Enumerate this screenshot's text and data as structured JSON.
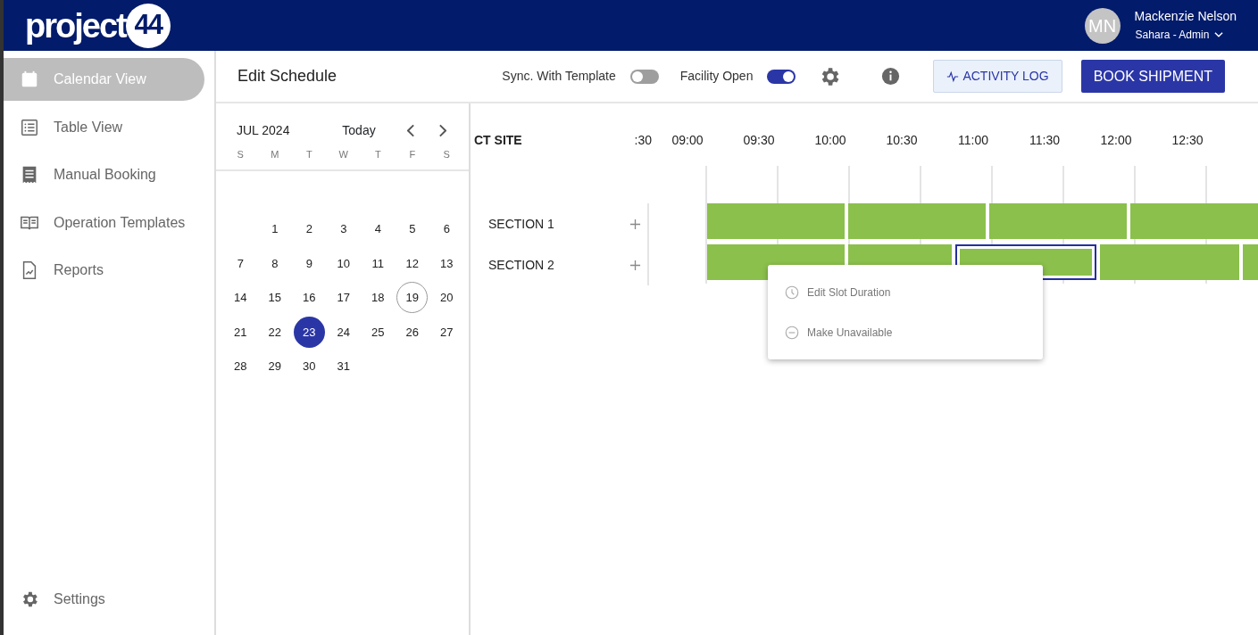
{
  "header": {
    "logo": {
      "word": "project",
      "number": "44"
    },
    "user": {
      "initials": "MN",
      "name": "Mackenzie Nelson",
      "role": "Sahara - Admin"
    }
  },
  "sidebar": {
    "items": [
      {
        "label": "Calendar View",
        "selected": true
      },
      {
        "label": "Table View",
        "selected": false
      },
      {
        "label": "Manual Booking",
        "selected": false
      },
      {
        "label": "Operation Templates",
        "selected": false
      },
      {
        "label": "Reports",
        "selected": false
      }
    ],
    "footer": {
      "label": "Settings"
    }
  },
  "toolbar": {
    "title": "Edit Schedule",
    "toggles": [
      {
        "label": "Sync. With Template",
        "on": false
      },
      {
        "label": "Facility Open",
        "on": true
      }
    ],
    "buttons": [
      {
        "label": "ACTIVITY LOG",
        "kind": "secondary"
      },
      {
        "label": "BOOK SHIPMENT",
        "kind": "primary"
      }
    ]
  },
  "calendar": {
    "month": "JUL 2024",
    "today_button": "Today",
    "weekdays": [
      "S",
      "M",
      "T",
      "W",
      "T",
      "F",
      "S"
    ],
    "days": [
      {
        "label": "1",
        "selected": false,
        "today": false
      },
      {
        "label": "2",
        "selected": false,
        "today": false
      },
      {
        "label": "3",
        "selected": false,
        "today": false
      },
      {
        "label": "4",
        "selected": false,
        "today": false
      },
      {
        "label": "5",
        "selected": false,
        "today": false
      },
      {
        "label": "6",
        "selected": false,
        "today": false
      },
      {
        "label": "7",
        "selected": false,
        "today": false
      },
      {
        "label": "8",
        "selected": false,
        "today": false
      },
      {
        "label": "9",
        "selected": false,
        "today": false
      },
      {
        "label": "10",
        "selected": false,
        "today": false
      },
      {
        "label": "11",
        "selected": false,
        "today": false
      },
      {
        "label": "12",
        "selected": false,
        "today": false
      },
      {
        "label": "13",
        "selected": false,
        "today": false
      },
      {
        "label": "14",
        "selected": false,
        "today": false
      },
      {
        "label": "15",
        "selected": false,
        "today": false
      },
      {
        "label": "16",
        "selected": false,
        "today": false
      },
      {
        "label": "17",
        "selected": false,
        "today": false
      },
      {
        "label": "18",
        "selected": false,
        "today": false
      },
      {
        "label": "19",
        "selected": false,
        "today": true
      },
      {
        "label": "20",
        "selected": false,
        "today": false
      },
      {
        "label": "21",
        "selected": false,
        "today": false
      },
      {
        "label": "22",
        "selected": false,
        "today": false
      },
      {
        "label": "23",
        "selected": true,
        "today": false
      },
      {
        "label": "24",
        "selected": false,
        "today": false
      },
      {
        "label": "25",
        "selected": false,
        "today": false
      },
      {
        "label": "26",
        "selected": false,
        "today": false
      },
      {
        "label": "27",
        "selected": false,
        "today": false
      },
      {
        "label": "28",
        "selected": false,
        "today": false
      },
      {
        "label": "29",
        "selected": false,
        "today": false
      },
      {
        "label": "30",
        "selected": false,
        "today": false
      },
      {
        "label": "31",
        "selected": false,
        "today": false
      }
    ]
  },
  "timeline": {
    "site": "CT SITE",
    "times": [
      ":30",
      "09:00",
      "09:30",
      "10:00",
      "10:30",
      "11:00",
      "11:30",
      "12:00",
      "12:30"
    ],
    "sections": [
      {
        "label": "SECTION 1",
        "slots": [
          {
            "selected": false
          },
          {
            "selected": false
          },
          {
            "selected": false
          },
          {
            "selected": false
          }
        ]
      },
      {
        "label": "SECTION 2",
        "slots": [
          {
            "selected": false
          },
          {
            "selected": false
          },
          {
            "selected": true
          },
          {
            "selected": false
          },
          {
            "selected": false
          }
        ]
      }
    ]
  },
  "context_menu": {
    "items": [
      {
        "label": "Edit Slot Duration"
      },
      {
        "label": "Make Unavailable"
      }
    ]
  }
}
